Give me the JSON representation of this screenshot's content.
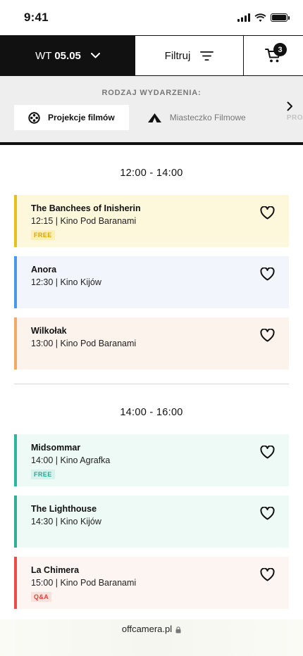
{
  "status_bar": {
    "time": "9:41"
  },
  "nav": {
    "day": "WT",
    "date": "05.05",
    "filter_label": "Filtruj",
    "cart_count": "3"
  },
  "event_type": {
    "heading": "RODZAJ WYDARZENIA:",
    "chips": [
      {
        "label": "Projekcje filmów",
        "icon": "film-reel-icon",
        "active": true
      },
      {
        "label": "Miasteczko Filmowe",
        "icon": "tent-icon",
        "active": false
      }
    ],
    "partial_label": "PRO"
  },
  "schedule": [
    {
      "time_range": "12:00 - 14:00",
      "events": [
        {
          "title": "The Banchees of Inisherin",
          "time": "12:15",
          "venue": "Kino Pod Baranami",
          "tag": "FREE",
          "accent": "#e4c21c",
          "bg": "#fdf7dc",
          "tag_color": "#d9a600",
          "tag_bg": "#fbeeb6"
        },
        {
          "title": "Anora",
          "time": "12:30",
          "venue": "Kino Kijów",
          "tag": "",
          "accent": "#4a98e8",
          "bg": "#f3f5fd"
        },
        {
          "title": "Wilkołak",
          "time": "13:00",
          "venue": "Kino Pod Baranami",
          "tag": "",
          "accent": "#f0aa66",
          "bg": "#fdf3ed"
        }
      ]
    },
    {
      "time_range": "14:00 - 16:00",
      "events": [
        {
          "title": "Midsommar",
          "time": "14:00",
          "venue": "Kino Agrafka",
          "tag": "FREE",
          "accent": "#2fb59f",
          "bg": "#edfaf6",
          "tag_color": "#2aa894",
          "tag_bg": "#d7f2ec"
        },
        {
          "title": "The Lighthouse",
          "time": "14:30",
          "venue": "Kino Kijów",
          "tag": "",
          "accent": "#2fae96",
          "bg": "#edfaf6"
        },
        {
          "title": "La Chimera",
          "time": "15:00",
          "venue": "Kino Pod Baranami",
          "tag": "Q&A",
          "accent": "#ec4b4b",
          "bg": "#fdf5f2",
          "tag_color": "#e0453f",
          "tag_bg": "#fbe0db"
        }
      ]
    }
  ],
  "url_bar": {
    "url": "offcamera.pl"
  }
}
